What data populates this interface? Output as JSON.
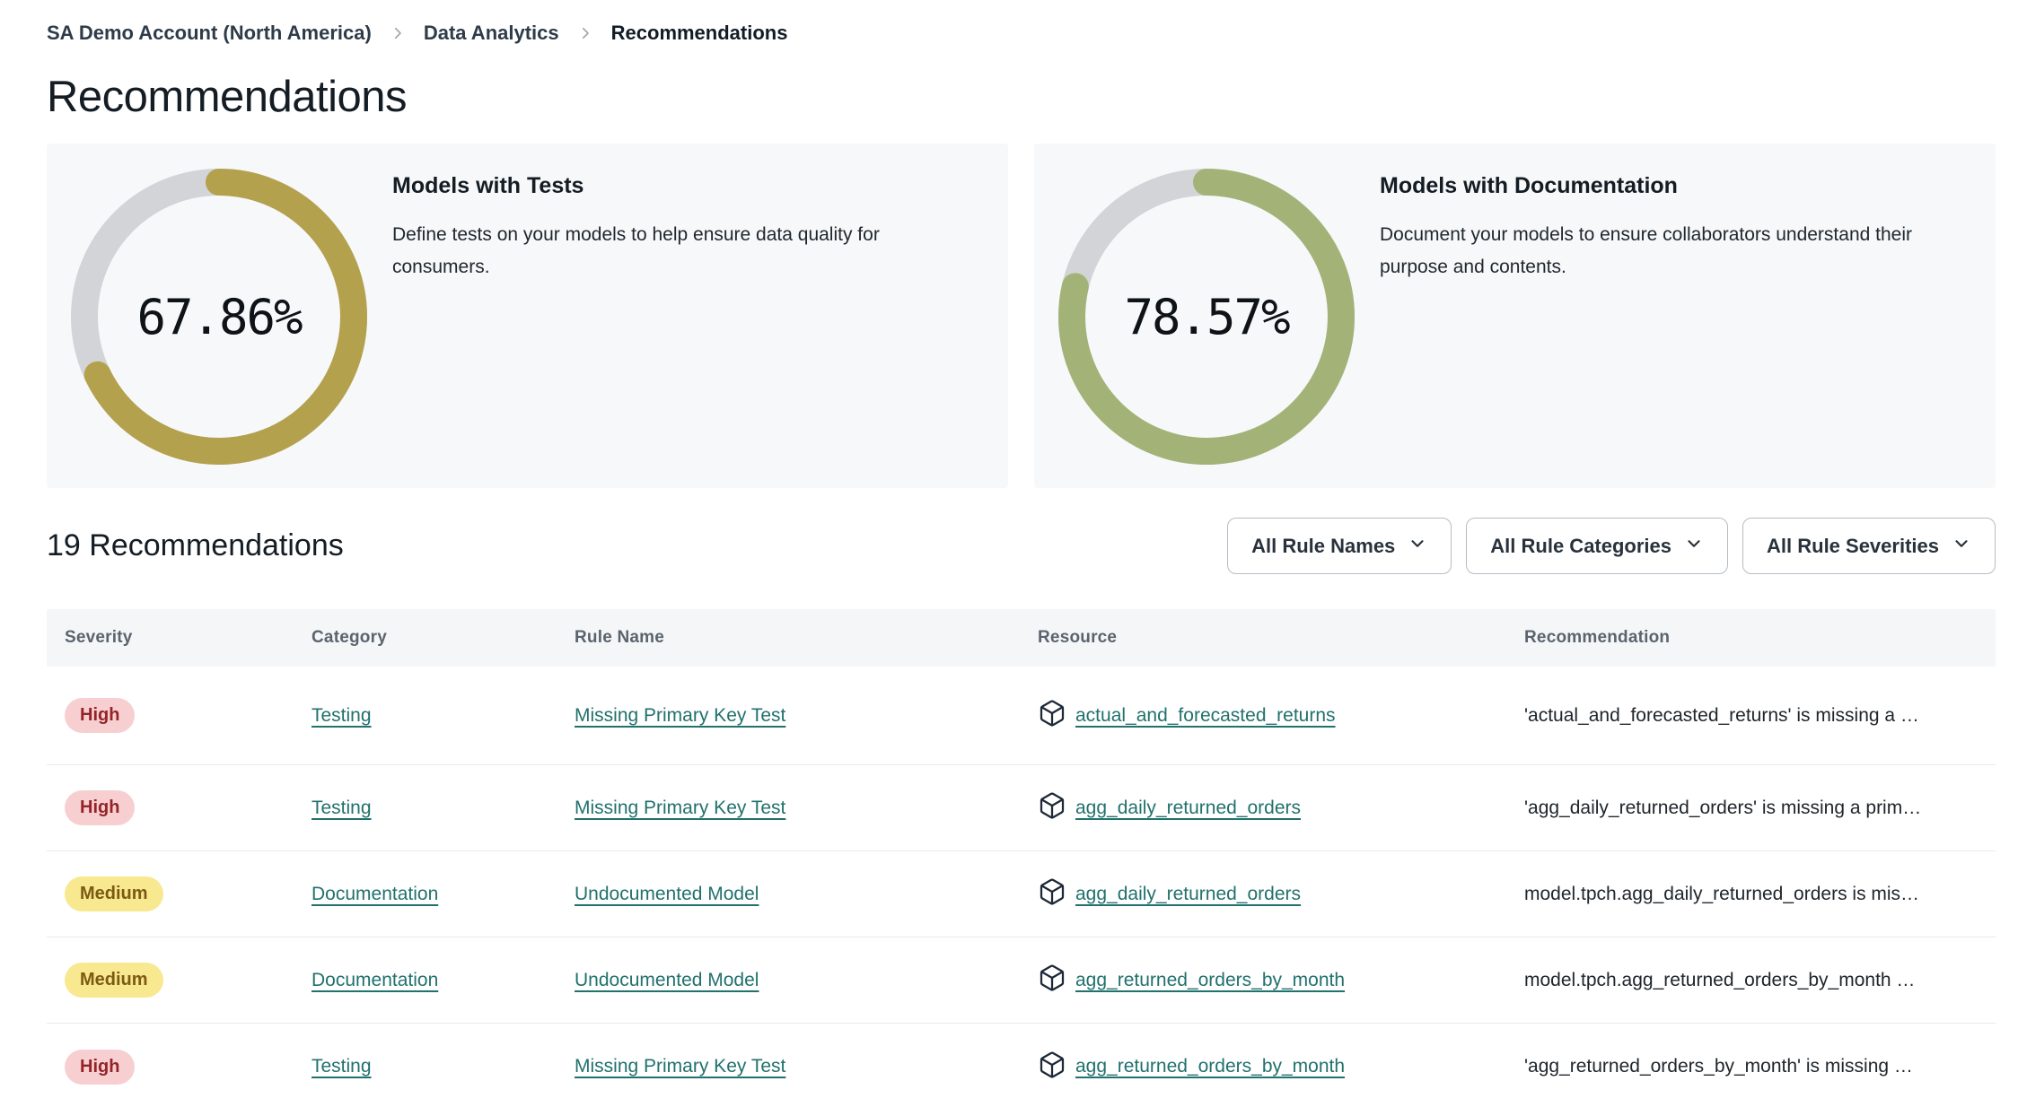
{
  "breadcrumb": {
    "items": [
      {
        "label": "SA Demo Account (North America)"
      },
      {
        "label": "Data Analytics"
      },
      {
        "label": "Recommendations"
      }
    ]
  },
  "page_title": "Recommendations",
  "cards": [
    {
      "title": "Models with Tests",
      "description": "Define tests on your models to help ensure data quality for consumers.",
      "percent": 67.86,
      "percent_label": "67.86%",
      "color": "#b4a14d"
    },
    {
      "title": "Models with Documentation",
      "description": "Document your models to ensure collaborators understand their purpose and contents.",
      "percent": 78.57,
      "percent_label": "78.57%",
      "color": "#a3b377"
    }
  ],
  "list_header": {
    "title": "19 Recommendations",
    "count": 19,
    "filters": [
      {
        "label": "All Rule Names"
      },
      {
        "label": "All Rule Categories"
      },
      {
        "label": "All Rule Severities"
      }
    ]
  },
  "table": {
    "columns": [
      "Severity",
      "Category",
      "Rule Name",
      "Resource",
      "Recommendation"
    ],
    "rows": [
      {
        "severity": "High",
        "severity_level": "high",
        "category": "Testing",
        "rule_name": "Missing Primary Key Test",
        "resource": "actual_and_forecasted_returns",
        "recommendation": "'actual_and_forecasted_returns' is missing a …"
      },
      {
        "severity": "High",
        "severity_level": "high",
        "category": "Testing",
        "rule_name": "Missing Primary Key Test",
        "resource": "agg_daily_returned_orders",
        "recommendation": "'agg_daily_returned_orders' is missing a prim…"
      },
      {
        "severity": "Medium",
        "severity_level": "medium",
        "category": "Documentation",
        "rule_name": "Undocumented Model",
        "resource": "agg_daily_returned_orders",
        "recommendation": "model.tpch.agg_daily_returned_orders is mis…"
      },
      {
        "severity": "Medium",
        "severity_level": "medium",
        "category": "Documentation",
        "rule_name": "Undocumented Model",
        "resource": "agg_returned_orders_by_month",
        "recommendation": "model.tpch.agg_returned_orders_by_month …"
      },
      {
        "severity": "High",
        "severity_level": "high",
        "category": "Testing",
        "rule_name": "Missing Primary Key Test",
        "resource": "agg_returned_orders_by_month",
        "recommendation": "'agg_returned_orders_by_month' is missing …"
      }
    ]
  },
  "colors": {
    "link_teal": "#21716d",
    "donut_track": "#d2d4d7",
    "donut_gold": "#b4a14d",
    "donut_green": "#a3b377",
    "severity_high_bg": "#f8cfd1",
    "severity_high_text": "#932428",
    "severity_medium_bg": "#f8e88f",
    "severity_medium_text": "#7c5a13",
    "card_bg": "#f7f8f9",
    "table_header_bg": "#f5f6f8"
  }
}
